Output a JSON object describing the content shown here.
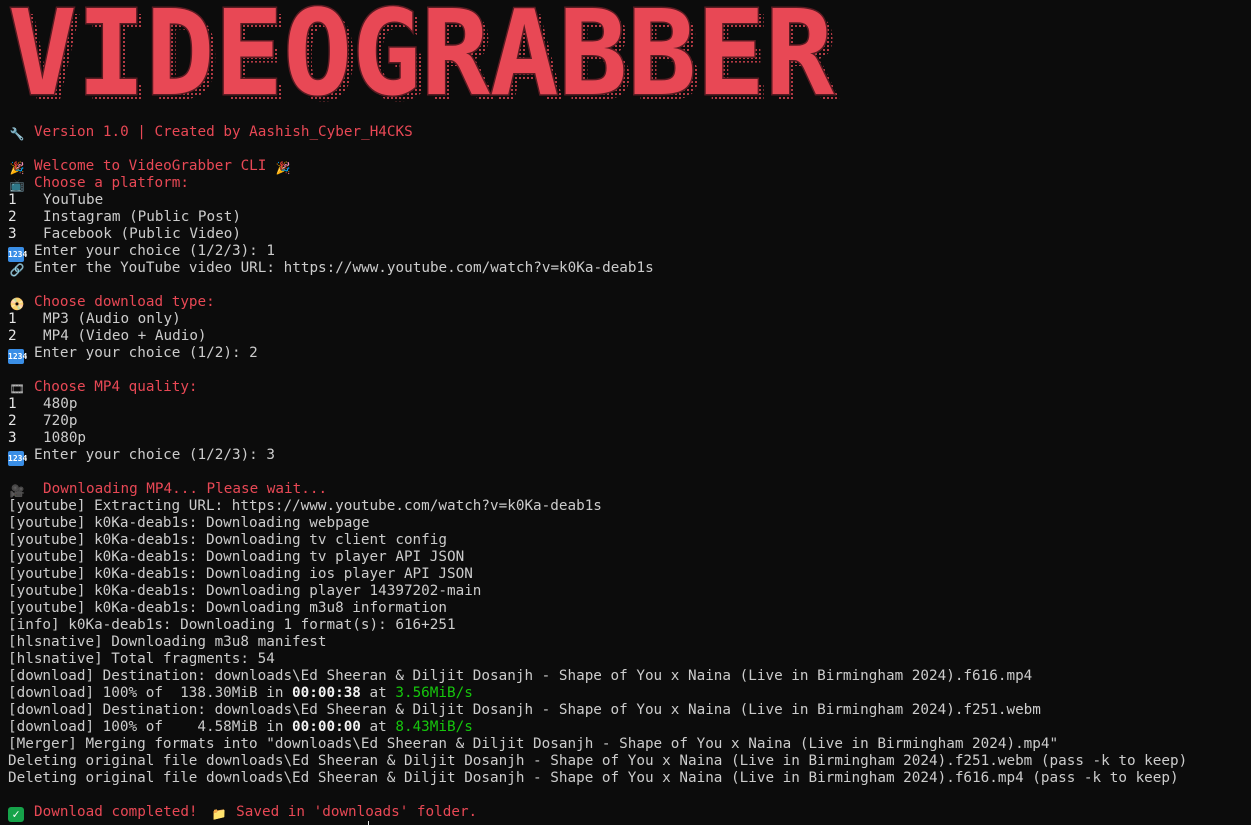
{
  "banner": {
    "logo_text": "VIDEOGRABBER"
  },
  "colors": {
    "background": "#0c0c0c",
    "accent_red": "#e84855",
    "speed_green": "#16c60c",
    "text": "#cccccc"
  },
  "header": {
    "version_icon": "wrench-icon",
    "version_line": "Version 1.0 | Created by Aashish_Cyber_H4CKS"
  },
  "welcome": {
    "icon": "party-popper-icon",
    "text": "Welcome to VideoGrabber CLI"
  },
  "platform_menu": {
    "icon": "tv-icon",
    "title": "Choose a platform:",
    "options": [
      {
        "num": "1",
        "label": "YouTube"
      },
      {
        "num": "2",
        "label": "Instagram (Public Post)"
      },
      {
        "num": "3",
        "label": "Facebook (Public Video)"
      }
    ],
    "prompt_icon": "keycap-1234-icon",
    "prompt": "Enter your choice (1/2/3): 1"
  },
  "url_prompt": {
    "icon": "link-icon",
    "text": "Enter the YouTube video URL: https://www.youtube.com/watch?v=k0Ka-deab1s"
  },
  "download_type_menu": {
    "icon": "dvd-icon",
    "title": "Choose download type:",
    "options": [
      {
        "num": "1",
        "label": "MP3 (Audio only)"
      },
      {
        "num": "2",
        "label": "MP4 (Video + Audio)"
      }
    ],
    "prompt": "Enter your choice (1/2): 2"
  },
  "quality_menu": {
    "icon": "film-frames-icon",
    "title": "Choose MP4 quality:",
    "options": [
      {
        "num": "1",
        "label": "480p"
      },
      {
        "num": "2",
        "label": "720p"
      },
      {
        "num": "3",
        "label": "1080p"
      }
    ],
    "prompt": "Enter your choice (1/2/3): 3"
  },
  "downloading": {
    "icon": "movie-camera-icon",
    "text": "Downloading MP4... Please wait..."
  },
  "log": {
    "l1": "[youtube] Extracting URL: https://www.youtube.com/watch?v=k0Ka-deab1s",
    "l2": "[youtube] k0Ka-deab1s: Downloading webpage",
    "l3": "[youtube] k0Ka-deab1s: Downloading tv client config",
    "l4": "[youtube] k0Ka-deab1s: Downloading tv player API JSON",
    "l5": "[youtube] k0Ka-deab1s: Downloading ios player API JSON",
    "l6": "[youtube] k0Ka-deab1s: Downloading player 14397202-main",
    "l7": "[youtube] k0Ka-deab1s: Downloading m3u8 information",
    "l8": "[info] k0Ka-deab1s: Downloading 1 format(s): 616+251",
    "l9": "[hlsnative] Downloading m3u8 manifest",
    "l10": "[hlsnative] Total fragments: 54",
    "l11": "[download] Destination: downloads\\Ed Sheeran & Diljit Dosanjh - Shape of You x Naina (Live in Birmingham 2024).f616.mp4",
    "p1_prefix": "[download] 100% of  138.30MiB in ",
    "p1_time": "00:00:38",
    "p1_at": " at ",
    "p1_speed": "3.56MiB/s",
    "l13": "[download] Destination: downloads\\Ed Sheeran & Diljit Dosanjh - Shape of You x Naina (Live in Birmingham 2024).f251.webm",
    "p2_prefix": "[download] 100% of    4.58MiB in ",
    "p2_time": "00:00:00",
    "p2_at": " at ",
    "p2_speed": "8.43MiB/s",
    "l15": "[Merger] Merging formats into \"downloads\\Ed Sheeran & Diljit Dosanjh - Shape of You x Naina (Live in Birmingham 2024).mp4\"",
    "l16": "Deleting original file downloads\\Ed Sheeran & Diljit Dosanjh - Shape of You x Naina (Live in Birmingham 2024).f251.webm (pass -k to keep)",
    "l17": "Deleting original file downloads\\Ed Sheeran & Diljit Dosanjh - Shape of You x Naina (Live in Birmingham 2024).f616.mp4 (pass -k to keep)"
  },
  "completion": {
    "check_icon": "check-mark-icon",
    "text_a": "Download completed!",
    "folder_icon": "folder-icon",
    "text_b": "Saved in 'downloads' folder."
  }
}
